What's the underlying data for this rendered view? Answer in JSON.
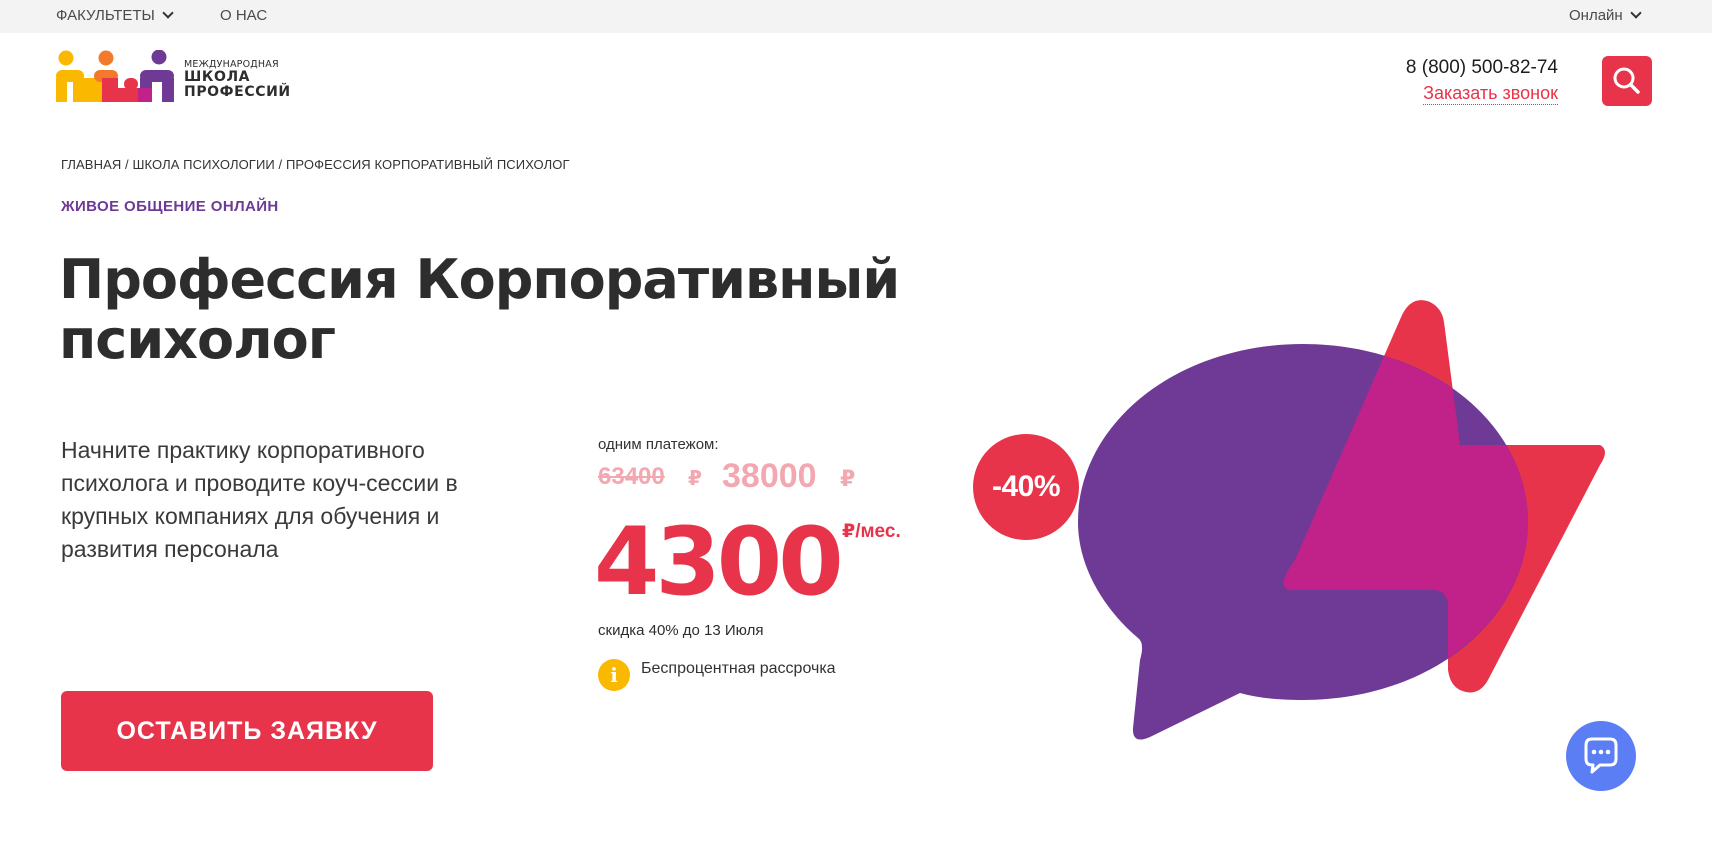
{
  "topbar": {
    "faculties_label": "ФАКУЛЬТЕТЫ",
    "about_label": "О НАС",
    "format_label": "Онлайн"
  },
  "logo": {
    "line1": "МЕЖДУНАРОДНАЯ",
    "line2": "ШКОЛА",
    "line3": "ПРОФЕССИЙ",
    "colors": [
      "#fbb800",
      "#f27a2a",
      "#e7344a",
      "#6e3a96"
    ]
  },
  "header": {
    "phone": "8 (800) 500-82-74",
    "callback_label": "Заказать звонок",
    "search_icon": "search-icon"
  },
  "breadcrumb": "ГЛАВНАЯ / ШКОЛА ПСИХОЛОГИИ / ПРОФЕССИЯ КОРПОРАТИВНЫЙ ПСИХОЛОГ",
  "hero": {
    "eyebrow": "ЖИВОЕ ОБЩЕНИЕ ОНЛАЙН",
    "title": "Профессия Корпоративный психолог",
    "description": "Начните практику корпоративного психолога и проводите коуч-сессии в крупных компаниях для обучения и развития персонала",
    "cta_label": "ОСТАВИТЬ ЗАЯВКУ"
  },
  "pricing": {
    "one_payment_label": "одним платежом:",
    "old_price": "63400",
    "mid_price": "38000",
    "currency": "₽",
    "monthly_price": "4300",
    "per_month": "₽/мес.",
    "discount_note": "скидка 40% до 13 Июля",
    "installment_label": "Беспроцентная рассрочка"
  },
  "badge": {
    "text": "-40%"
  },
  "colors": {
    "accent": "#e7344a",
    "purple": "#6e3a96",
    "magenta": "#c1228a",
    "chat": "#5b7ef5"
  }
}
